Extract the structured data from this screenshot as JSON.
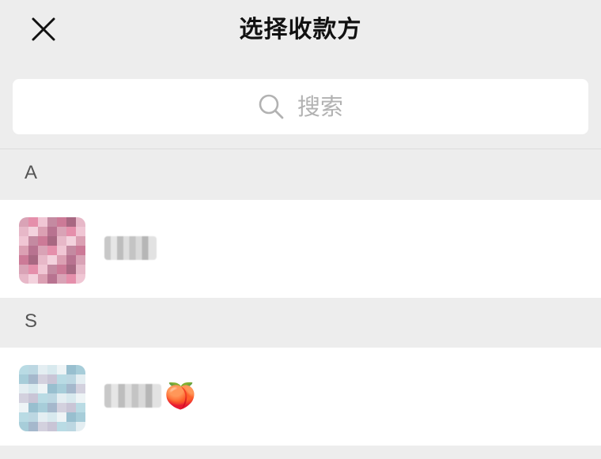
{
  "header": {
    "title": "选择收款方",
    "close_icon": "close-icon"
  },
  "search": {
    "placeholder": "搜索",
    "icon": "search-icon"
  },
  "sections": [
    {
      "letter": "A",
      "contacts": [
        {
          "name": "",
          "suffix": ""
        }
      ]
    },
    {
      "letter": "S",
      "contacts": [
        {
          "name": "",
          "suffix": "🍑"
        }
      ]
    }
  ],
  "colors": {
    "background": "#ededed",
    "card": "#ffffff",
    "placeholder": "#b2b2b2",
    "section_letter": "#555555"
  }
}
